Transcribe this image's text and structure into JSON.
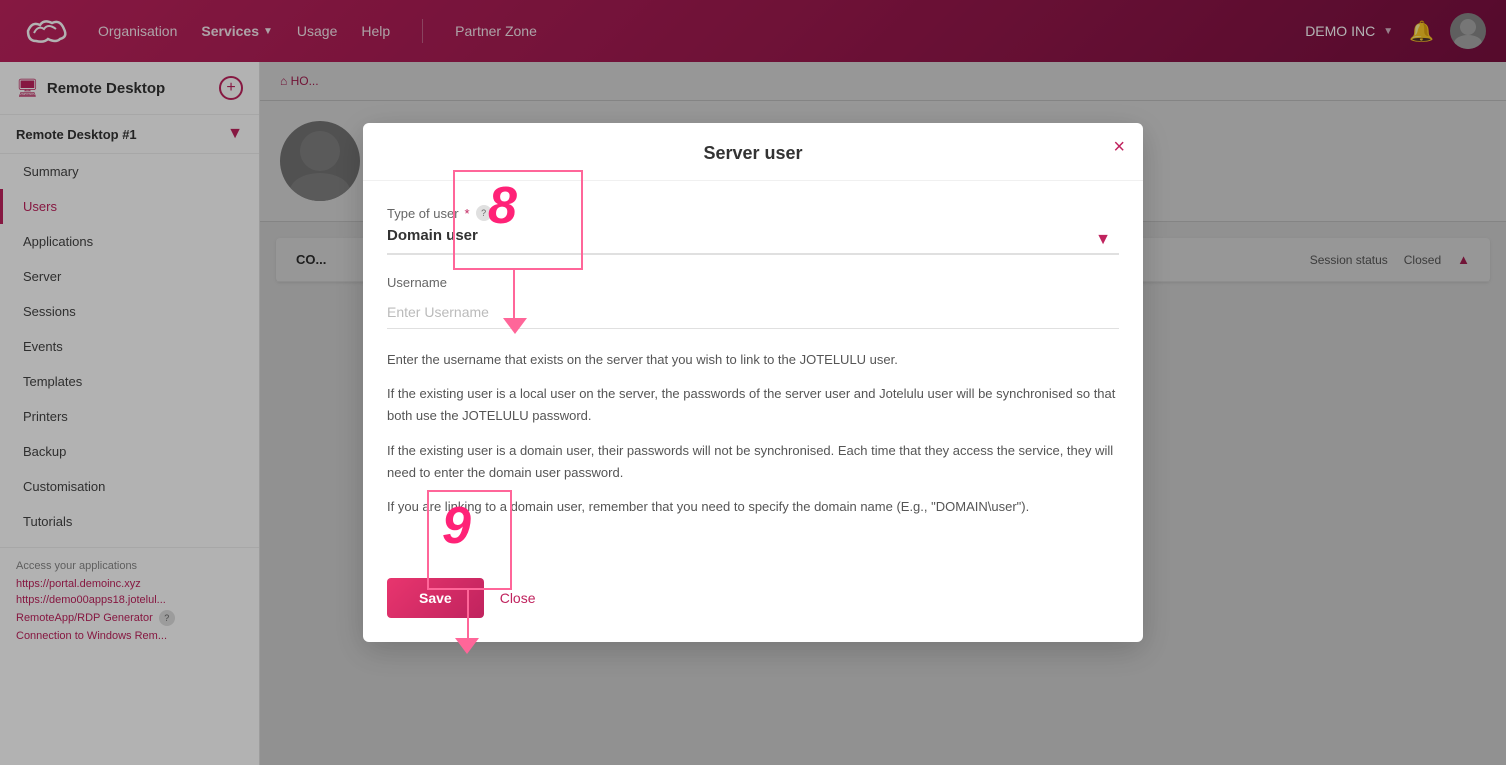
{
  "nav": {
    "logo_alt": "Jotelulu logo",
    "links": [
      {
        "label": "Organisation",
        "active": false
      },
      {
        "label": "Services",
        "active": true,
        "has_arrow": true
      },
      {
        "label": "Usage",
        "active": false
      },
      {
        "label": "Help",
        "active": false
      }
    ],
    "partner_zone": "Partner Zone",
    "company": "DEMO INC",
    "divider": "|"
  },
  "sidebar": {
    "header_title": "Remote Desktop",
    "instance_title": "Remote Desktop #1",
    "nav_items": [
      {
        "label": "Summary",
        "active": false
      },
      {
        "label": "Users",
        "active": true
      },
      {
        "label": "Applications",
        "active": false
      },
      {
        "label": "Server",
        "active": false
      },
      {
        "label": "Sessions",
        "active": false
      },
      {
        "label": "Events",
        "active": false
      },
      {
        "label": "Templates",
        "active": false
      },
      {
        "label": "Printers",
        "active": false
      },
      {
        "label": "Backup",
        "active": false
      },
      {
        "label": "Customisation",
        "active": false
      },
      {
        "label": "Tutorials",
        "active": false
      }
    ],
    "access_title": "Access your applications",
    "access_links": [
      "https://portal.demoinc.xyz",
      "https://demo00apps18.jotelul..."
    ],
    "app_links": [
      {
        "label": "RemoteApp/RDP Generator"
      },
      {
        "label": "Connection to Windows Rem..."
      }
    ]
  },
  "modal": {
    "title": "Server user",
    "close_label": "×",
    "form": {
      "type_of_user_label": "Type of user",
      "type_of_user_required": "*",
      "type_of_user_help": "?",
      "type_of_user_value": "Domain user",
      "username_label": "Username",
      "username_placeholder": "Enter Username"
    },
    "info_paragraphs": [
      "Enter the username that exists on the server that you wish to link to the JOTELULU user.",
      "If the existing user is a local user on the server, the passwords of the server user and Jotelulu user will be synchronised so that both use the JOTELULU password.",
      "If the existing user is a domain user, their passwords will not be synchronised. Each time that they access the service, they will need to enter the domain user password.",
      "If you are linking to a domain user, remember that you need to specify the domain name (E.g., \"DOMAIN\\user\")."
    ],
    "save_label": "Save",
    "close_link_label": "Close"
  },
  "content": {
    "breadcrumb": "HO...",
    "section_title": "CO...",
    "session_status_label": "Session status",
    "session_status_value": "Closed"
  },
  "annotations": {
    "number_8": "8",
    "number_9": "9"
  }
}
